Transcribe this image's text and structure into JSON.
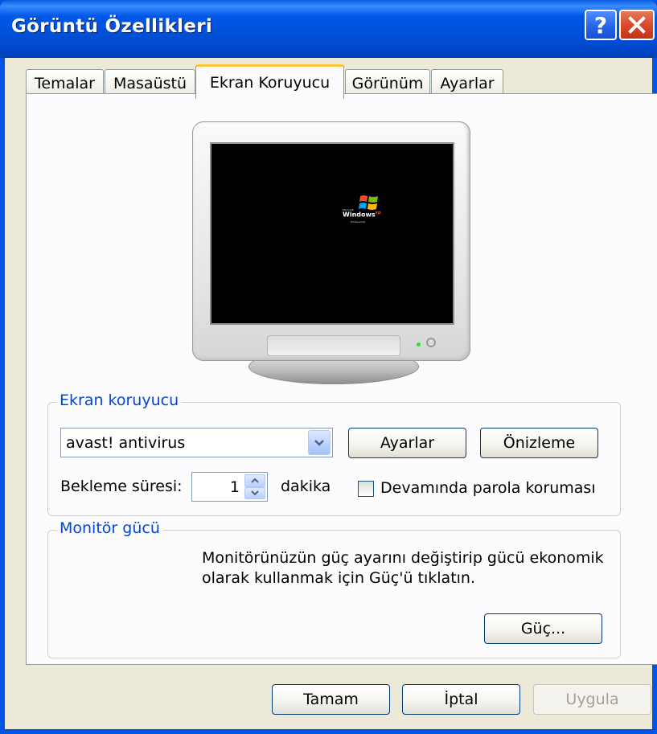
{
  "window": {
    "title": "Görüntü Özellikleri",
    "help_label": "?",
    "close_label": "✕"
  },
  "tabs": [
    {
      "label": "Temalar"
    },
    {
      "label": "Masaüstü"
    },
    {
      "label": "Ekran Koruyucu",
      "active": true
    },
    {
      "label": "Görünüm"
    },
    {
      "label": "Ayarlar"
    }
  ],
  "preview": {
    "logo_text": "Windows",
    "logo_sup": "xp",
    "logo_edition": "Professional",
    "logo_prefix": "Microsoft"
  },
  "screensaver": {
    "group_label": "Ekran koruyucu",
    "selected": "avast! antivirus",
    "settings_button": "Ayarlar",
    "preview_button": "Önizleme",
    "wait_label": "Bekleme süresi:",
    "wait_value": "1",
    "wait_unit": "dakika",
    "password_label": "Devamında parola koruması",
    "password_checked": false
  },
  "power": {
    "group_label": "Monitör gücü",
    "description_line1": "Monitörünüzün güç ayarını değiştirip gücü ekonomik",
    "description_line2": "olarak kullanmak için Güç'ü tıklatın.",
    "power_button": "Güç..."
  },
  "footer": {
    "ok": "Tamam",
    "cancel": "İptal",
    "apply": "Uygula"
  },
  "colors": {
    "title_bar": "#0054E3",
    "group_label": "#0046D5",
    "tab_highlight": "#FFC83C"
  }
}
